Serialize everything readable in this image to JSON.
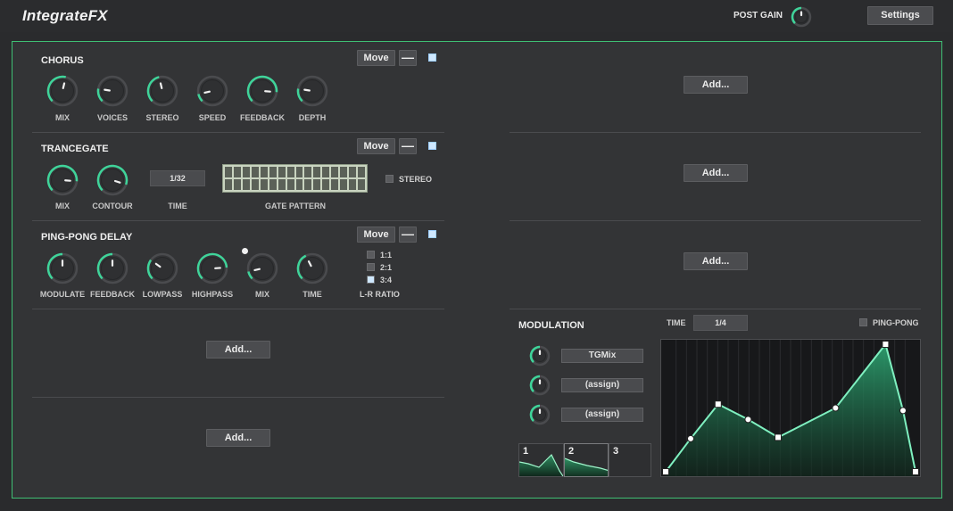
{
  "app": {
    "title": "IntegrateFX"
  },
  "header": {
    "post_gain_label": "POST GAIN",
    "post_gain_value": 0.5,
    "settings_label": "Settings"
  },
  "colors": {
    "accent": "#3fd49a",
    "frame": "#3fbf74",
    "panel": "#333436"
  },
  "common": {
    "move_label": "Move",
    "remove_label": "—",
    "add_label": "Add..."
  },
  "chorus": {
    "title": "CHORUS",
    "knobs": [
      {
        "label": "MIX",
        "value": 0.55
      },
      {
        "label": "VOICES",
        "value": 0.2
      },
      {
        "label": "STEREO",
        "value": 0.45
      },
      {
        "label": "SPEED",
        "value": 0.12
      },
      {
        "label": "FEEDBACK",
        "value": 0.85
      },
      {
        "label": "DEPTH",
        "value": 0.2
      }
    ]
  },
  "trancegate": {
    "title": "TRANCEGATE",
    "knobs": [
      {
        "label": "MIX",
        "value": 0.85
      },
      {
        "label": "CONTOUR",
        "value": 0.9
      }
    ],
    "time_value": "1/32",
    "time_label": "TIME",
    "gate_label": "GATE PATTERN",
    "stereo_label": "STEREO",
    "stereo_on": false
  },
  "pingpong": {
    "title": "PING-PONG DELAY",
    "knobs": [
      {
        "label": "MODULATE",
        "value": 0.5
      },
      {
        "label": "FEEDBACK",
        "value": 0.5
      },
      {
        "label": "LOWPASS",
        "value": 0.3
      },
      {
        "label": "HIGHPASS",
        "value": 0.82
      },
      {
        "label": "MIX",
        "value": 0.12
      },
      {
        "label": "TIME",
        "value": 0.4
      }
    ],
    "ratio_options": [
      {
        "label": "1:1",
        "selected": false
      },
      {
        "label": "2:1",
        "selected": false
      },
      {
        "label": "3:4",
        "selected": true
      }
    ],
    "ratio_label": "L-R RATIO"
  },
  "modulation": {
    "title": "MODULATION",
    "time_label": "TIME",
    "time_value": "1/4",
    "pingpong_label": "PING-PONG",
    "pingpong_on": false,
    "targets": [
      {
        "label": "TGMix",
        "amount": 0.5
      },
      {
        "label": "(assign)",
        "amount": 0.5
      },
      {
        "label": "(assign)",
        "amount": 0.5
      }
    ],
    "lfo_tabs": [
      "1",
      "2",
      "3"
    ],
    "envelope_points": [
      [
        0.0,
        0.0
      ],
      [
        0.1,
        0.26
      ],
      [
        0.21,
        0.53
      ],
      [
        0.33,
        0.41
      ],
      [
        0.45,
        0.27
      ],
      [
        0.68,
        0.5
      ],
      [
        0.88,
        1.0
      ],
      [
        0.95,
        0.48
      ],
      [
        1.0,
        0.0
      ]
    ]
  }
}
